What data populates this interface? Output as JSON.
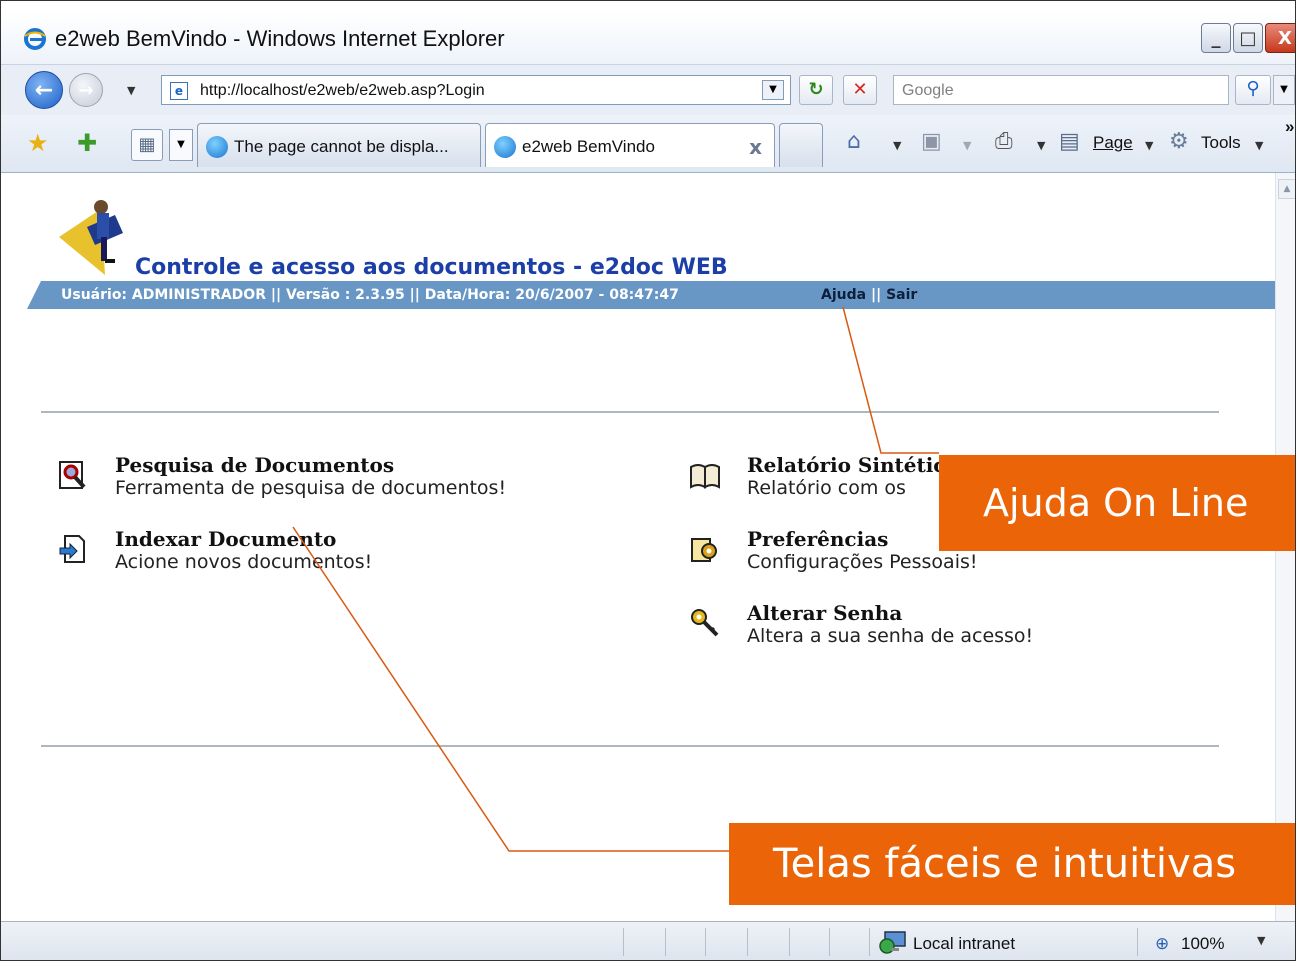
{
  "window": {
    "title": "e2web BemVindo - Windows Internet Explorer",
    "min_glyph": "_",
    "max_glyph": "□",
    "close_glyph": "X"
  },
  "address_bar": {
    "url": "http://localhost/e2web/e2web.asp?Login",
    "search_placeholder": "Google"
  },
  "tabs": [
    {
      "label": "The page cannot be displa...",
      "active": false
    },
    {
      "label": "e2web BemVindo",
      "active": true,
      "close": "x"
    }
  ],
  "command_bar": {
    "page_label": "Page",
    "tools_label": "Tools",
    "more": "»"
  },
  "page": {
    "app_title": "Controle e acesso aos documentos - e2doc WEB",
    "info_text": "Usuário: ADMINISTRADOR || Versão : 2.3.95 || Data/Hora: 20/6/2007 - 08:47:47",
    "help_link": "Ajuda",
    "separator": " || ",
    "exit_link": "Sair"
  },
  "menu": {
    "left": [
      {
        "title": "Pesquisa de Documentos",
        "desc": "Ferramenta de pesquisa de documentos!",
        "icon": "search-document-icon"
      },
      {
        "title": "Indexar Documento",
        "desc": "Acione novos documentos!",
        "icon": "import-document-icon"
      }
    ],
    "right": [
      {
        "title": "Relatório Sintético",
        "desc": "Relatório com os",
        "icon": "book-icon"
      },
      {
        "title": "Preferências",
        "desc": "Configurações Pessoais!",
        "icon": "preferences-icon"
      },
      {
        "title": "Alterar Senha",
        "desc": "Altera a sua senha de acesso!",
        "icon": "key-icon"
      }
    ]
  },
  "annotations": {
    "help_callout": "Ajuda On Line",
    "screens_callout": "Telas fáceis e intuitivas"
  },
  "status_bar": {
    "zone": "Local intranet",
    "zoom": "100%"
  },
  "colors": {
    "callout": "#eb6408",
    "title_blue": "#1b3fa6",
    "info_bar": "#6897c6"
  }
}
